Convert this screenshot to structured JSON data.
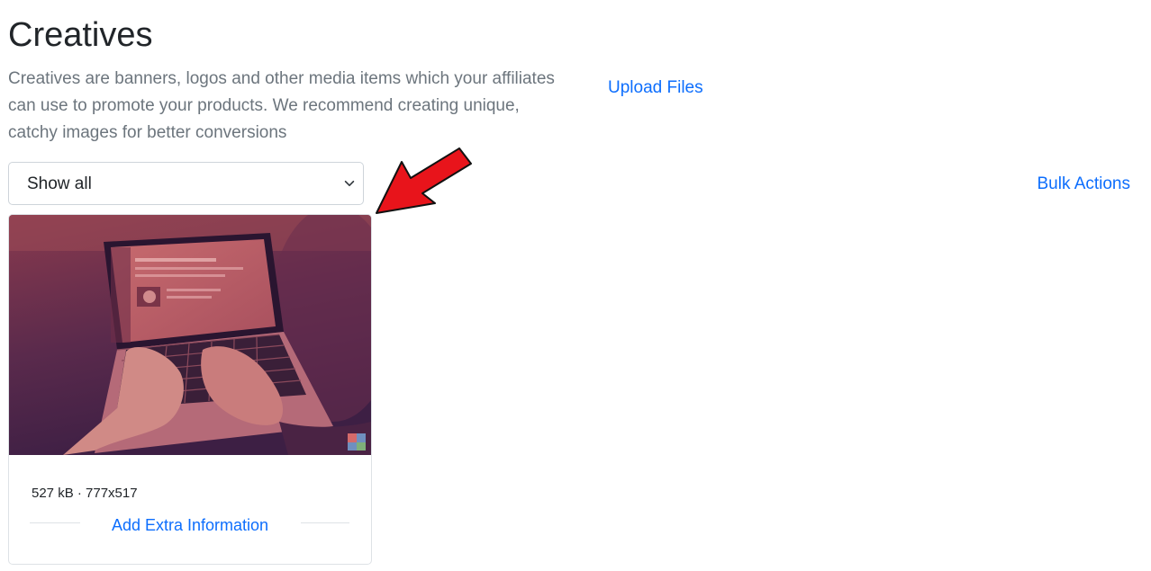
{
  "header": {
    "title": "Creatives",
    "description": "Creatives are banners, logos and other media items which your affiliates can use to promote your products. We recommend creating unique, catchy images for better conversions"
  },
  "actions": {
    "upload_label": "Upload Files",
    "bulk_label": "Bulk Actions"
  },
  "filter": {
    "selected": "Show all"
  },
  "creatives": [
    {
      "meta": "527 kB · 777x517",
      "extra_info_label": "Add Extra Information"
    }
  ],
  "colors": {
    "link": "#0d6efd",
    "annotation_arrow": "#e8141b",
    "image_tint_top": "#8a3a4e",
    "image_tint_bottom": "#3d1f44"
  },
  "icons": {
    "select": "chevron-down-icon",
    "annotation": "red-arrow-icon"
  }
}
